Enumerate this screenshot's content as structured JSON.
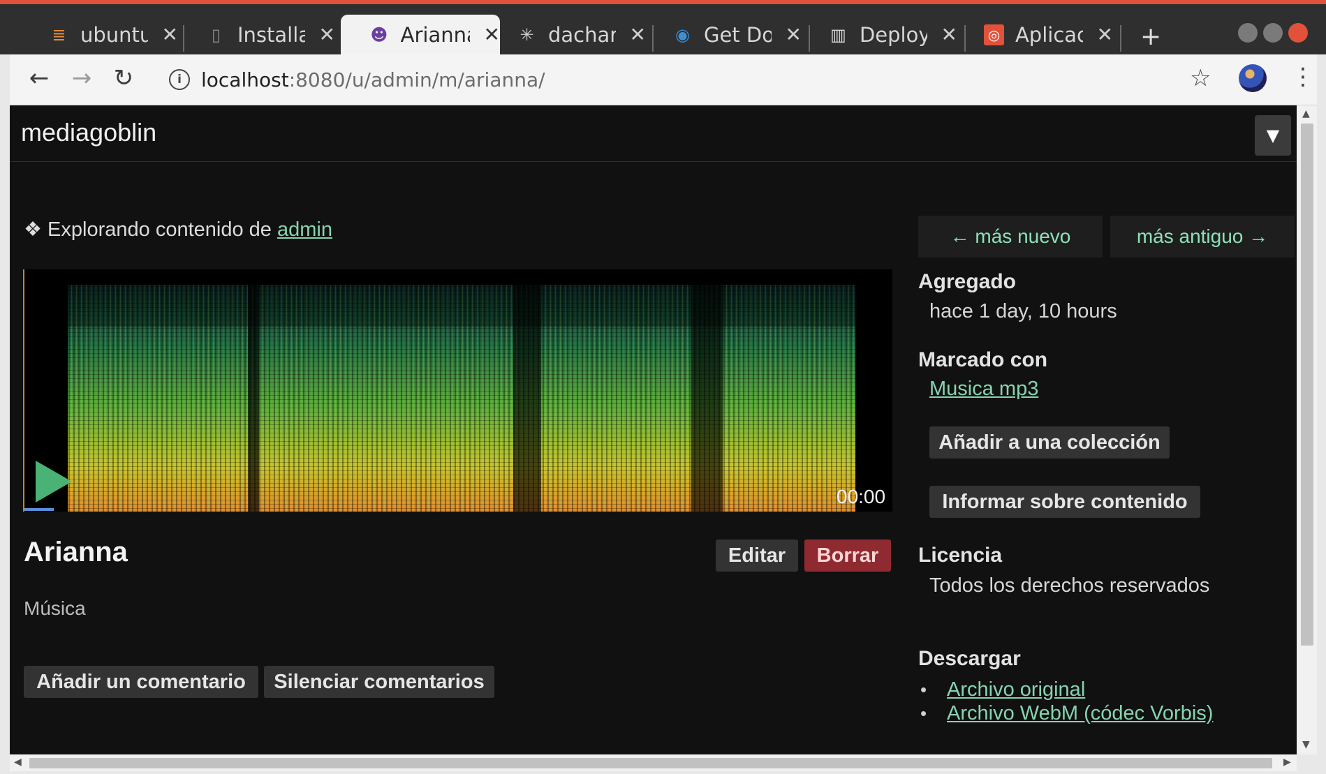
{
  "browser": {
    "tabs": [
      {
        "label": "ubuntu",
        "icon": "stack-icon",
        "active": false
      },
      {
        "label": "Installa",
        "icon": "page-icon",
        "active": false
      },
      {
        "label": "Arianna",
        "icon": "goblin-icon",
        "active": true
      },
      {
        "label": "dachar",
        "icon": "spider-icon",
        "active": false
      },
      {
        "label": "Get Do",
        "icon": "globe-icon",
        "active": false
      },
      {
        "label": "Deploy",
        "icon": "book-icon",
        "active": false
      },
      {
        "label": "Aplicac",
        "icon": "ubuntu-icon",
        "active": false
      }
    ],
    "url_host": "localhost",
    "url_path": ":8080/u/admin/m/arianna/"
  },
  "site": {
    "logo": "mediagoblin"
  },
  "breadcrumb": {
    "prefix": "❖ Explorando contenido de ",
    "user": "admin"
  },
  "player": {
    "time": "00:00",
    "progress": 0.0
  },
  "media": {
    "title": "Arianna",
    "edit_label": "Editar",
    "delete_label": "Borrar",
    "type": "Música",
    "add_comment_label": "Añadir un comentario",
    "mute_comments_label": "Silenciar comentarios"
  },
  "sidebar": {
    "newer_label": "← más nuevo",
    "older_label": "más antiguo →",
    "added_heading": "Agregado",
    "added_value": "hace 1 day, 10 hours",
    "tagged_heading": "Marcado con",
    "tag": "Musica mp3",
    "add_collection_label": "Añadir a una colección",
    "report_label": "Informar sobre contenido",
    "license_heading": "Licencia",
    "license_value": "Todos los derechos reservados",
    "download_heading": "Descargar",
    "downloads": [
      "Archivo original",
      "Archivo WebM (códec Vorbis)"
    ]
  },
  "colors": {
    "accent": "#e2513a",
    "link": "#86d4b1",
    "danger": "#8f2a31",
    "page_bg": "#111111"
  }
}
